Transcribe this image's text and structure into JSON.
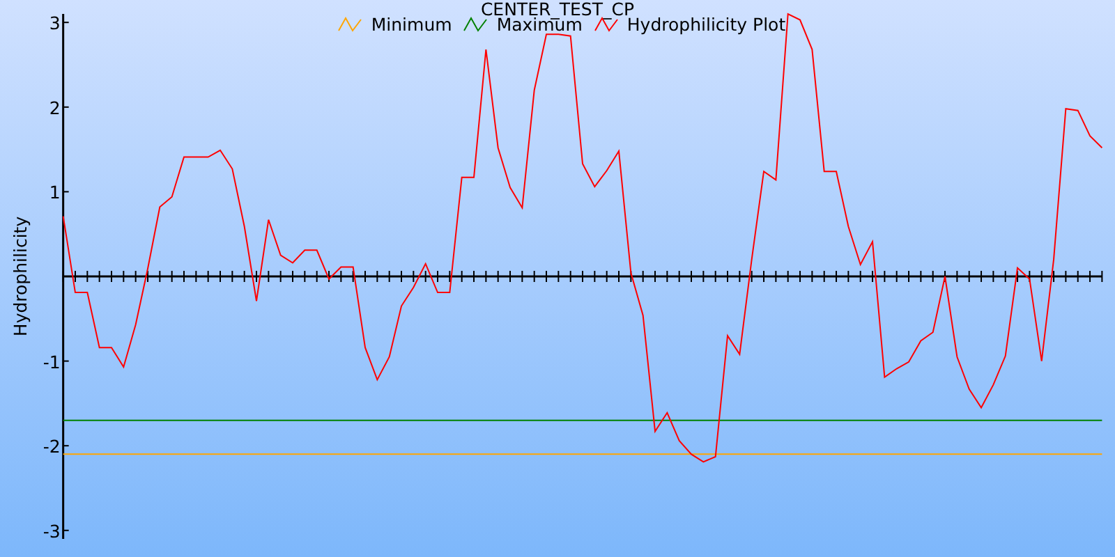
{
  "chart": {
    "chart_data": {
      "type": "line",
      "title": "CENTER_TEST_CP",
      "ylabel": "Hydrophilicity",
      "ylim": [
        -3.1,
        3.1
      ],
      "yticks": [
        -3,
        -2,
        -1,
        1,
        2,
        3
      ],
      "series": [
        {
          "name": "Minimum",
          "color": "#ffa500",
          "values": [
            -2.1,
            -2.1,
            -2.1,
            -2.1,
            -2.1,
            -2.1,
            -2.1,
            -2.1,
            -2.1,
            -2.1,
            -2.1,
            -2.1,
            -2.1,
            -2.1,
            -2.1,
            -2.1,
            -2.1,
            -2.1,
            -2.1,
            -2.1,
            -2.1,
            -2.1,
            -2.1,
            -2.1,
            -2.1,
            -2.1,
            -2.1,
            -2.1,
            -2.1,
            -2.1,
            -2.1,
            -2.1,
            -2.1,
            -2.1,
            -2.1,
            -2.1,
            -2.1,
            -2.1,
            -2.1,
            -2.1,
            -2.1,
            -2.1,
            -2.1,
            -2.1,
            -2.1,
            -2.1,
            -2.1,
            -2.1,
            -2.1,
            -2.1,
            -2.1,
            -2.1,
            -2.1,
            -2.1,
            -2.1,
            -2.1,
            -2.1,
            -2.1,
            -2.1,
            -2.1,
            -2.1,
            -2.1,
            -2.1,
            -2.1,
            -2.1,
            -2.1,
            -2.1,
            -2.1,
            -2.1,
            -2.1,
            -2.1,
            -2.1,
            -2.1,
            -2.1,
            -2.1,
            -2.1,
            -2.1,
            -2.1,
            -2.1,
            -2.1,
            -2.1,
            -2.1,
            -2.1,
            -2.1,
            -2.1,
            -2.1,
            -2.1
          ]
        },
        {
          "name": "Maximum",
          "color": "#008000",
          "values": [
            -1.7,
            -1.7,
            -1.7,
            -1.7,
            -1.7,
            -1.7,
            -1.7,
            -1.7,
            -1.7,
            -1.7,
            -1.7,
            -1.7,
            -1.7,
            -1.7,
            -1.7,
            -1.7,
            -1.7,
            -1.7,
            -1.7,
            -1.7,
            -1.7,
            -1.7,
            -1.7,
            -1.7,
            -1.7,
            -1.7,
            -1.7,
            -1.7,
            -1.7,
            -1.7,
            -1.7,
            -1.7,
            -1.7,
            -1.7,
            -1.7,
            -1.7,
            -1.7,
            -1.7,
            -1.7,
            -1.7,
            -1.7,
            -1.7,
            -1.7,
            -1.7,
            -1.7,
            -1.7,
            -1.7,
            -1.7,
            -1.7,
            -1.7,
            -1.7,
            -1.7,
            -1.7,
            -1.7,
            -1.7,
            -1.7,
            -1.7,
            -1.7,
            -1.7,
            -1.7,
            -1.7,
            -1.7,
            -1.7,
            -1.7,
            -1.7,
            -1.7,
            -1.7,
            -1.7,
            -1.7,
            -1.7,
            -1.7,
            -1.7,
            -1.7,
            -1.7,
            -1.7,
            -1.7,
            -1.7,
            -1.7,
            -1.7,
            -1.7,
            -1.7,
            -1.7,
            -1.7,
            -1.7,
            -1.7,
            -1.7,
            -1.7
          ]
        },
        {
          "name": "Hydrophilicity Plot",
          "color": "#ff0000",
          "values": [
            0.71,
            -0.19,
            -0.19,
            -0.84,
            -0.84,
            -1.07,
            -0.57,
            0.09,
            0.82,
            0.94,
            1.41,
            1.41,
            1.41,
            1.49,
            1.27,
            0.59,
            -0.29,
            0.67,
            0.25,
            0.16,
            0.31,
            0.31,
            -0.03,
            0.11,
            0.11,
            -0.84,
            -1.22,
            -0.95,
            -0.35,
            -0.13,
            0.15,
            -0.19,
            -0.19,
            1.17,
            1.17,
            2.68,
            1.52,
            1.05,
            0.81,
            2.2,
            2.86,
            2.86,
            2.84,
            1.33,
            1.06,
            1.25,
            1.48,
            0.04,
            -0.46,
            -1.83,
            -1.61,
            -1.94,
            -2.1,
            -2.19,
            -2.13,
            -0.7,
            -0.92,
            0.2,
            1.24,
            1.14,
            3.1,
            3.03,
            2.68,
            1.24,
            1.24,
            0.59,
            0.14,
            0.41,
            -1.19,
            -1.09,
            -1.01,
            -0.76,
            -0.66,
            0.0,
            -0.95,
            -1.33,
            -1.55,
            -1.28,
            -0.94,
            0.1,
            -0.03,
            -1.0,
            0.2,
            1.98,
            1.96,
            1.66,
            1.52
          ]
        }
      ]
    }
  }
}
